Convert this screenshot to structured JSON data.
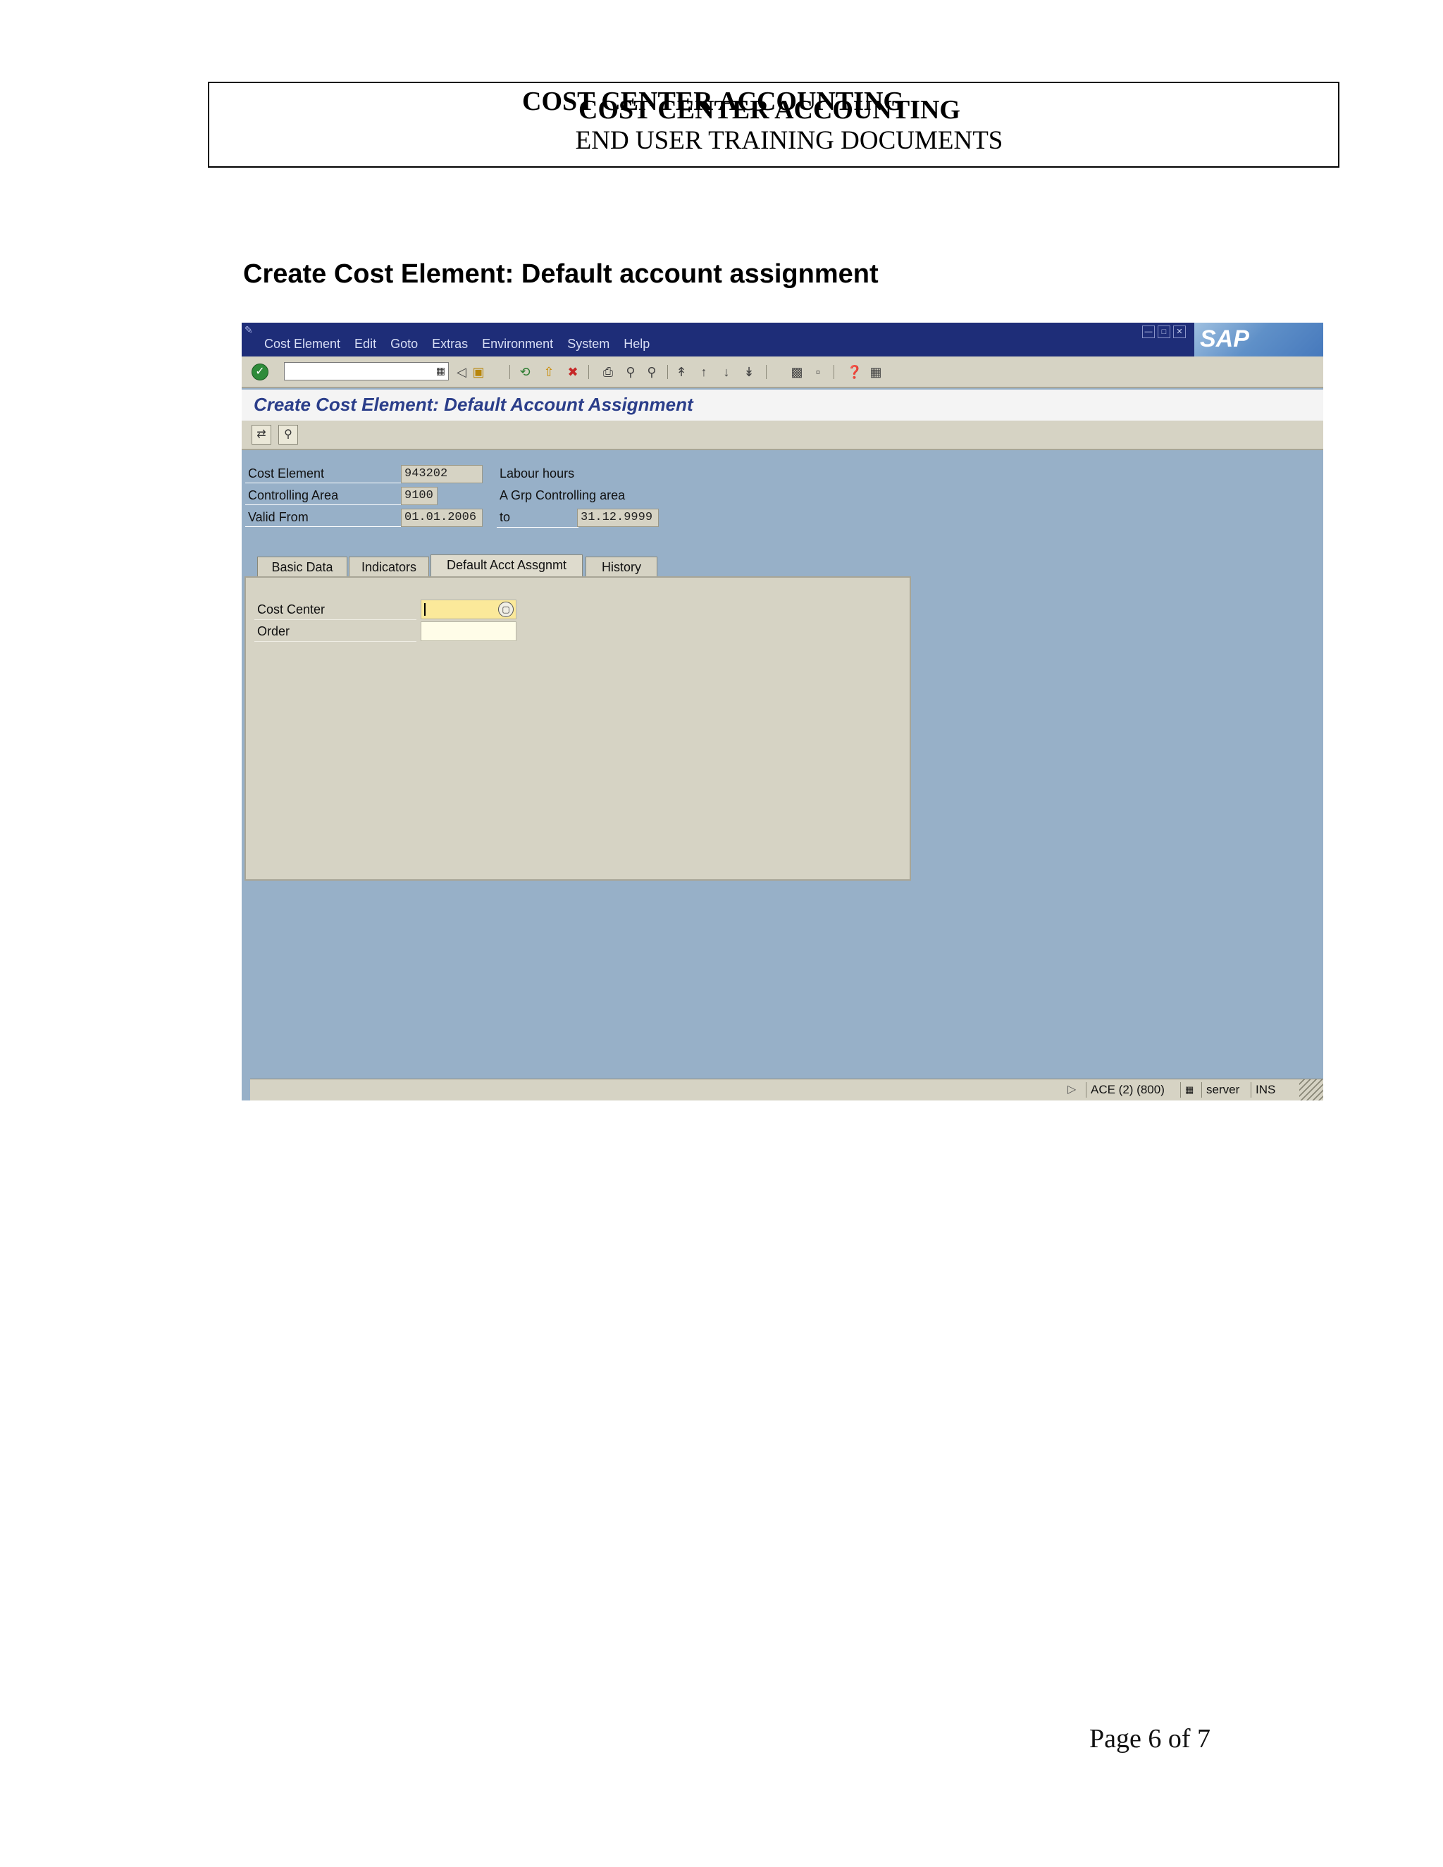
{
  "doc_header": {
    "title": "COST CENTER ACCOUNTING",
    "subtitle": "END USER TRAINING DOCUMENTS"
  },
  "section_title": "Create Cost Element: Default account assignment",
  "sap": {
    "menu": [
      "Cost Element",
      "Edit",
      "Goto",
      "Extras",
      "Environment",
      "System",
      "Help"
    ],
    "logo": "SAP",
    "screen_title": "Create Cost Element: Default Account Assignment",
    "header_fields": {
      "cost_element_label": "Cost Element",
      "cost_element_value": "943202",
      "cost_element_desc": "Labour hours",
      "controlling_area_label": "Controlling Area",
      "controlling_area_value": "9100",
      "controlling_area_desc": "A Grp Controlling area",
      "valid_from_label": "Valid From",
      "valid_from_value": "01.01.2006",
      "to_label": "to",
      "valid_to_value": "31.12.9999"
    },
    "tabs": [
      {
        "label": "Basic Data",
        "active": false
      },
      {
        "label": "Indicators",
        "active": false
      },
      {
        "label": "Default Acct Assgnmt",
        "active": true
      },
      {
        "label": "History",
        "active": false
      }
    ],
    "panel": {
      "cost_center_label": "Cost Center",
      "cost_center_value": "",
      "order_label": "Order",
      "order_value": ""
    },
    "status": {
      "system": "ACE (2) (800)",
      "server": "server",
      "mode": "INS"
    }
  },
  "page_number": "Page 6 of 7"
}
